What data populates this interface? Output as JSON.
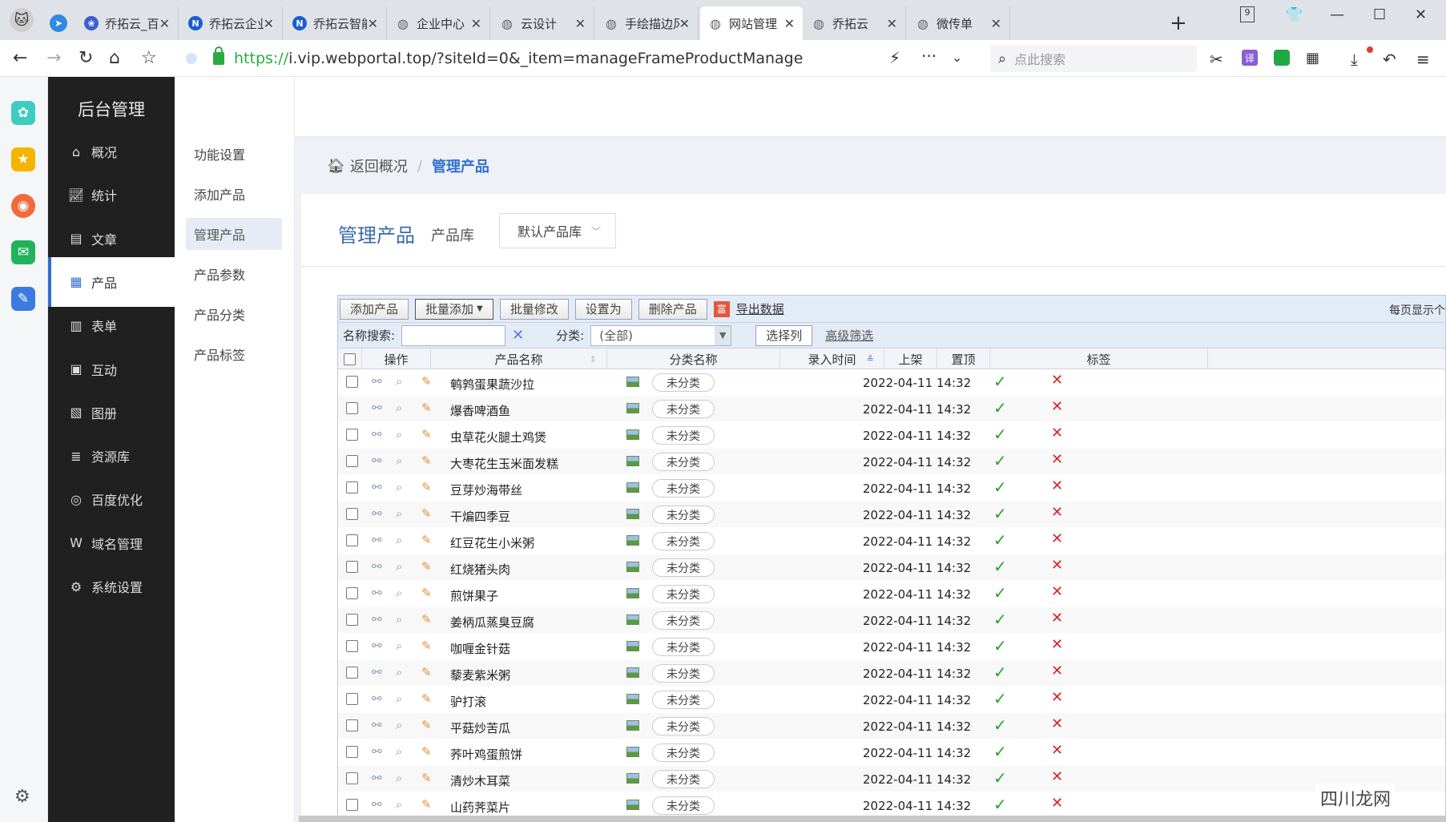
{
  "browser": {
    "tabs": [
      {
        "label": "乔拓云_百度",
        "icon": "paw-icon",
        "color": "#3e5fd0"
      },
      {
        "label": "乔拓云企业",
        "icon": "n-logo-icon",
        "color": "#1a5fd0"
      },
      {
        "label": "乔拓云智能",
        "icon": "n-logo-icon",
        "color": "#1a5fd0"
      },
      {
        "label": "企业中心",
        "icon": "globe-icon",
        "color": "#666666"
      },
      {
        "label": "云设计",
        "icon": "globe-icon",
        "color": "#666666"
      },
      {
        "label": "手绘描边风",
        "icon": "globe-icon",
        "color": "#666666"
      },
      {
        "label": "网站管理",
        "icon": "globe-icon",
        "color": "#666666",
        "active": true
      },
      {
        "label": "乔拓云",
        "icon": "globe-icon",
        "color": "#666666"
      },
      {
        "label": "微传单",
        "icon": "globe-icon",
        "color": "#666666"
      }
    ],
    "tab_count": "9",
    "url_scheme": "https://",
    "url_rest": "i.vip.webportal.top/?siteId=0&_item=manageFrameProductManage",
    "search_placeholder": "点此搜索"
  },
  "admin": {
    "title": "后台管理",
    "nav": [
      {
        "label": "概况",
        "icon": "home-icon"
      },
      {
        "label": "统计",
        "icon": "chart-icon"
      },
      {
        "label": "文章",
        "icon": "article-icon"
      },
      {
        "label": "产品",
        "icon": "grid-icon",
        "active": true
      },
      {
        "label": "表单",
        "icon": "form-icon"
      },
      {
        "label": "互动",
        "icon": "chat-icon"
      },
      {
        "label": "图册",
        "icon": "album-icon"
      },
      {
        "label": "资源库",
        "icon": "database-icon"
      },
      {
        "label": "百度优化",
        "icon": "target-icon"
      },
      {
        "label": "域名管理",
        "icon": "domain-icon"
      },
      {
        "label": "系统设置",
        "icon": "gear-icon"
      }
    ],
    "submenu": [
      {
        "label": "功能设置"
      },
      {
        "label": "添加产品"
      },
      {
        "label": "管理产品",
        "active": true
      },
      {
        "label": "产品参数"
      },
      {
        "label": "产品分类"
      },
      {
        "label": "产品标签"
      }
    ]
  },
  "breadcrumb": {
    "back": "返回概况",
    "current": "管理产品"
  },
  "page": {
    "title": "管理产品",
    "library_label": "产品库",
    "library_value": "默认产品库"
  },
  "toolbar": {
    "add": "添加产品",
    "batch_add": "批量添加",
    "batch_edit": "批量修改",
    "set_as": "设置为",
    "delete": "删除产品",
    "export_icon_text": "富",
    "export": "导出数据",
    "per_page": "每页显示个"
  },
  "filter": {
    "name_label": "名称搜索:",
    "category_label": "分类:",
    "category_value": "(全部)",
    "choose_columns": "选择列",
    "advanced": "高级筛选"
  },
  "columns": [
    "操作",
    "产品名称",
    "分类名称",
    "录入时间",
    "上架",
    "置顶",
    "标签"
  ],
  "rows": [
    {
      "name": "鹌鹑蛋果蔬沙拉",
      "category": "未分类",
      "time": "2022-04-11 14:32"
    },
    {
      "name": "爆香啤酒鱼",
      "category": "未分类",
      "time": "2022-04-11 14:32"
    },
    {
      "name": "虫草花火腿土鸡煲",
      "category": "未分类",
      "time": "2022-04-11 14:32"
    },
    {
      "name": "大枣花生玉米面发糕",
      "category": "未分类",
      "time": "2022-04-11 14:32"
    },
    {
      "name": "豆芽炒海带丝",
      "category": "未分类",
      "time": "2022-04-11 14:32"
    },
    {
      "name": "干煸四季豆",
      "category": "未分类",
      "time": "2022-04-11 14:32"
    },
    {
      "name": "红豆花生小米粥",
      "category": "未分类",
      "time": "2022-04-11 14:32"
    },
    {
      "name": "红烧猪头肉",
      "category": "未分类",
      "time": "2022-04-11 14:32"
    },
    {
      "name": "煎饼果子",
      "category": "未分类",
      "time": "2022-04-11 14:32"
    },
    {
      "name": "姜柄瓜蒸臭豆腐",
      "category": "未分类",
      "time": "2022-04-11 14:32"
    },
    {
      "name": "咖喱金针菇",
      "category": "未分类",
      "time": "2022-04-11 14:32"
    },
    {
      "name": "藜麦紫米粥",
      "category": "未分类",
      "time": "2022-04-11 14:32"
    },
    {
      "name": "驴打滚",
      "category": "未分类",
      "time": "2022-04-11 14:32"
    },
    {
      "name": "平菇炒苦瓜",
      "category": "未分类",
      "time": "2022-04-11 14:32"
    },
    {
      "name": "荞叶鸡蛋煎饼",
      "category": "未分类",
      "time": "2022-04-11 14:32"
    },
    {
      "name": "清炒木耳菜",
      "category": "未分类",
      "time": "2022-04-11 14:32"
    },
    {
      "name": "山药荠菜片",
      "category": "未分类",
      "time": "2022-04-11 14:32"
    }
  ],
  "watermark": "四川龙网"
}
